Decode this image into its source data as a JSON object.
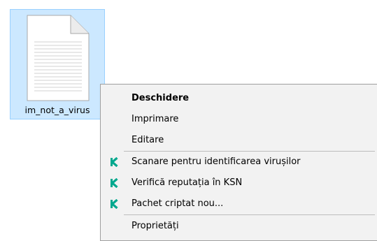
{
  "file": {
    "name": "im_not_a_virus",
    "icon": "text-document-icon"
  },
  "context_menu": {
    "items": [
      {
        "label": "Deschidere",
        "bold": true
      },
      {
        "label": "Imprimare"
      },
      {
        "label": "Editare"
      },
      {
        "label": "Scanare pentru identificarea virușilor",
        "icon": "kaspersky-k-icon"
      },
      {
        "label": "Verifică reputația în KSN",
        "icon": "kaspersky-k-icon"
      },
      {
        "label": "Pachet criptat nou...",
        "icon": "kaspersky-k-icon"
      },
      {
        "label": "Proprietăți"
      }
    ]
  },
  "colors": {
    "selection_bg": "#cce8ff",
    "selection_border": "#99d1ff",
    "menu_bg": "#f2f2f2",
    "kaspersky_green": "#00a88e"
  }
}
